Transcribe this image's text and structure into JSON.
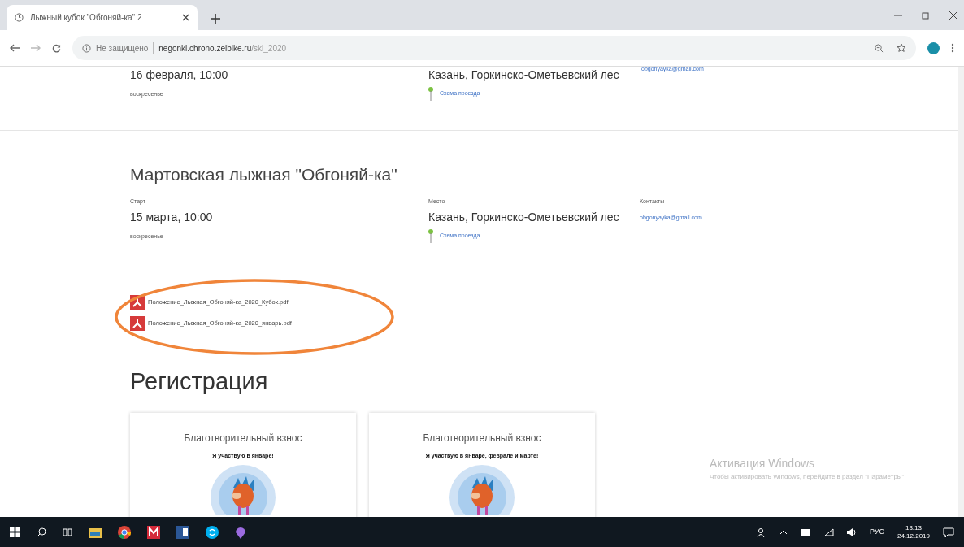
{
  "browser": {
    "tab_title": "Лыжный кубок \"Обгоняй-ка\" 2",
    "security": "Не защищено",
    "url_host": "negonki.chrono.zelbike.ru",
    "url_path": "/ski_2020"
  },
  "events": [
    {
      "date": "16 февраля, 10:00",
      "weekday": "воскресенье",
      "place": "Казань, Горкинско-Ометьевский лес",
      "route_link": "Схема проезда",
      "email": "obgonyayka@gmail.com"
    },
    {
      "title": "Мартовская лыжная \"Обгоняй-ка\"",
      "start_label": "Старт",
      "place_label": "Место",
      "contacts_label": "Контакты",
      "date": "15 марта, 10:00",
      "weekday": "воскресенье",
      "place": "Казань, Горкинско-Ометьевский лес",
      "route_link": "Схема проезда",
      "email": "obgonyayka@gmail.com"
    }
  ],
  "documents": [
    {
      "name": "Положение_Лыжная_Обгоняй-ка_2020_Кубок.pdf"
    },
    {
      "name": "Положение_Лыжная_Обгоняй-ка_2020_январь.pdf"
    }
  ],
  "registration": {
    "heading": "Регистрация",
    "cards": [
      {
        "title": "Благотворительный взнос",
        "subtitle": "Я участвую в январе!",
        "kind": "picture"
      },
      {
        "title": "Благотворительный взнос",
        "subtitle": "Я участвую в январе, феврале и марте!",
        "kind": "picture"
      }
    ]
  },
  "windows_activation": {
    "title": "Активация Windows",
    "text": "Чтобы активировать Windows, перейдите в раздел \"Параметры\""
  },
  "taskbar": {
    "language": "РУС",
    "time": "13:13",
    "date": "24.12.2019"
  }
}
